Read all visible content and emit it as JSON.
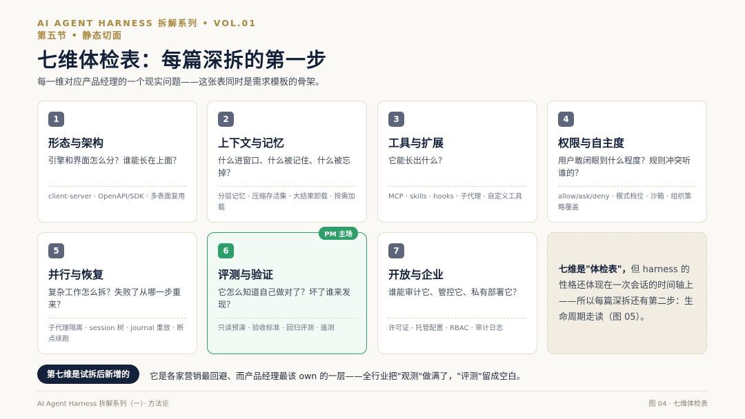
{
  "header": {
    "kicker": "AI AGENT HARNESS 拆解系列 • VOL.01",
    "section": "第五节 • 静态切面",
    "title": "七维体检表：每篇深拆的第一步",
    "subtitle": "每一维对应产品经理的一个现实问题——这张表同时是需求模板的骨架。"
  },
  "cards": [
    {
      "num": "1",
      "title": "形态与架构",
      "question": "引擎和界面怎么分？谁能长在上面？",
      "tags": "client-server · OpenAPI/SDK · 多表面复用"
    },
    {
      "num": "2",
      "title": "上下文与记忆",
      "question": "什么进窗口、什么被记住、什么被忘掉？",
      "tags": "分层记忆 · 压缩存活集 · 大结果卸载 · 按需加载"
    },
    {
      "num": "3",
      "title": "工具与扩展",
      "question": "它能长出什么？",
      "tags": "MCP · skills · hooks · 子代理 · 自定义工具"
    },
    {
      "num": "4",
      "title": "权限与自主度",
      "question": "用户敢闭眼到什么程度？规则冲突听谁的？",
      "tags": "allow/ask/deny · 模式档位 · 沙箱 · 组织策略覆盖"
    },
    {
      "num": "5",
      "title": "并行与恢复",
      "question": "复杂工作怎么拆？失败了从哪一步重来？",
      "tags": "子代理隔离 · session 树 · journal 重放 · 断点续跑"
    },
    {
      "num": "6",
      "title": "评测与验证",
      "question": "它怎么知道自己做对了？坏了谁来发现？",
      "tags": "只读预演 · 验收标准 · 回归评测 · 遥测",
      "badge": "PM 主场"
    },
    {
      "num": "7",
      "title": "开放与企业",
      "question": "谁能审计它、管控它、私有部署它？",
      "tags": "许可证 · 托管配置 · RBAC · 审计日志"
    }
  ],
  "note": {
    "bold": "七维是\"体检表\"，",
    "text": "但 harness 的性格还体现在一次会话的时间轴上——所以每篇深拆还有第二步：生命周期走读（图 05）。"
  },
  "callout": {
    "pill": "第七维是试拆后新增的",
    "text": "它是各家营销最回避、而产品经理最该 own 的一层——全行业把\"观测\"做满了，\"评测\"留成空白。"
  },
  "footer": {
    "left": "AI Agent Harness 拆解系列（一）· 方法论",
    "right": "图 04 · 七维体检表"
  }
}
